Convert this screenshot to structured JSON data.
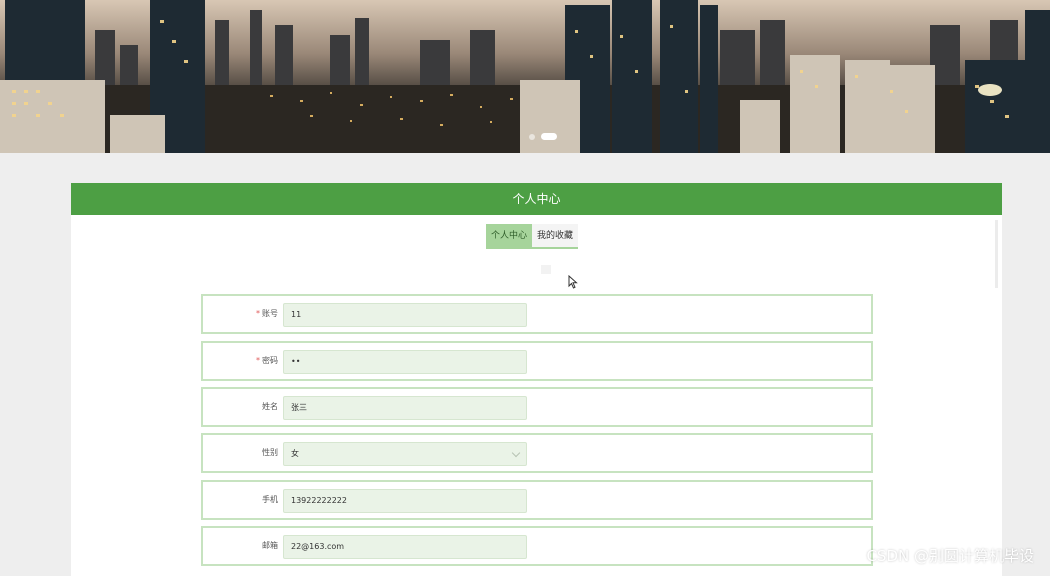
{
  "header": {
    "title": "个人中心"
  },
  "tabs": [
    {
      "label": "个人中心",
      "active": true
    },
    {
      "label": "我的收藏",
      "active": false
    }
  ],
  "banner": {
    "slides": 2,
    "active_slide": 2
  },
  "form": {
    "fields": [
      {
        "label": "账号",
        "required": true,
        "value": "11",
        "type": "text"
      },
      {
        "label": "密码",
        "required": true,
        "value": "••",
        "type": "password"
      },
      {
        "label": "姓名",
        "required": false,
        "value": "张三",
        "type": "text"
      },
      {
        "label": "性别",
        "required": false,
        "value": "女",
        "type": "select"
      },
      {
        "label": "手机",
        "required": false,
        "value": "13922222222",
        "type": "text"
      },
      {
        "label": "邮箱",
        "required": false,
        "value": "22@163.com",
        "type": "text"
      }
    ]
  },
  "watermark": "CSDN @别圆计算机毕设",
  "colors": {
    "accent": "#4d9f44",
    "tab_active": "#a6d49b",
    "input_bg": "#eaf3e7",
    "row_border": "#c7e3c0"
  }
}
